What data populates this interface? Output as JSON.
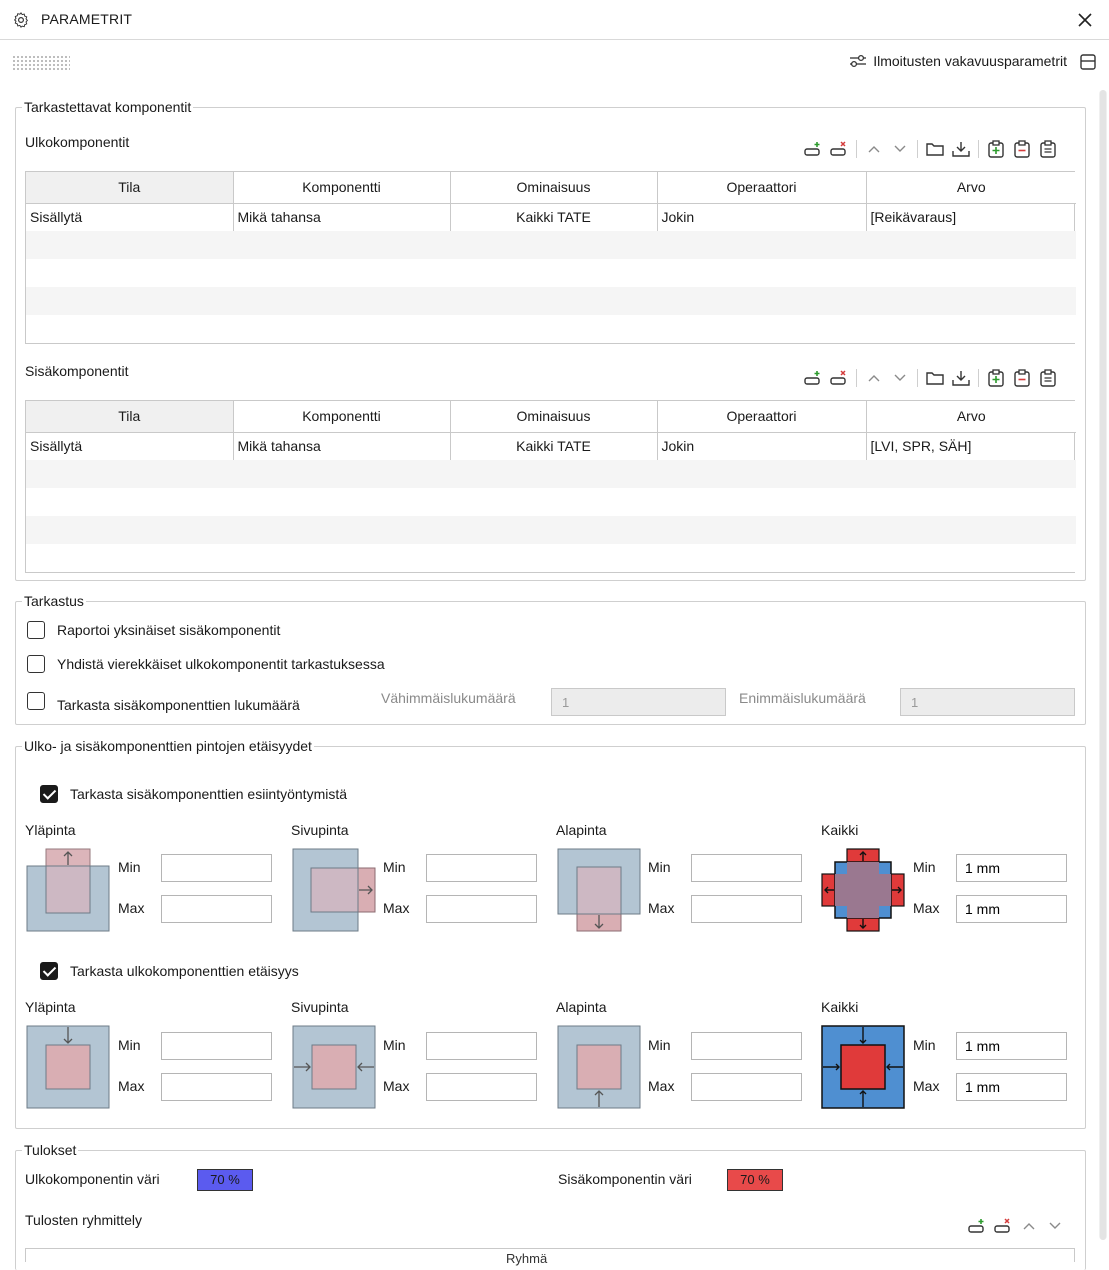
{
  "window": {
    "title": "PARAMETRIT"
  },
  "header": {
    "severity_link": "Ilmoitusten vakavuusparametrit"
  },
  "components": {
    "legend": "Tarkastettavat komponentit",
    "outer": {
      "title": "Ulkokomponentit",
      "columns": [
        "Tila",
        "Komponentti",
        "Ominaisuus",
        "Operaattori",
        "Arvo"
      ],
      "rows": [
        {
          "tila": "Sisällytä",
          "komponentti": "Mikä tahansa",
          "ominaisuus": "Kaikki TATE",
          "operaattori": "Jokin",
          "arvo": "[Reikävaraus]"
        }
      ]
    },
    "inner": {
      "title": "Sisäkomponentit",
      "columns": [
        "Tila",
        "Komponentti",
        "Ominaisuus",
        "Operaattori",
        "Arvo"
      ],
      "rows": [
        {
          "tila": "Sisällytä",
          "komponentti": "Mikä tahansa",
          "ominaisuus": "Kaikki TATE",
          "operaattori": "Jokin",
          "arvo": "[LVI, SPR, SÄH]"
        }
      ]
    }
  },
  "check": {
    "legend": "Tarkastus",
    "options": [
      {
        "label": "Raportoi yksinäiset sisäkomponentit",
        "checked": false
      },
      {
        "label": "Yhdistä vierekkäiset ulkokomponentit tarkastuksessa",
        "checked": false
      },
      {
        "label": "Tarkasta sisäkomponenttien lukumäärä",
        "checked": false
      }
    ],
    "min_count_label": "Vähimmäislukumäärä",
    "min_count_value": "1",
    "max_count_label": "Enimmäislukumäärä",
    "max_count_value": "1"
  },
  "distances": {
    "legend": "Ulko- ja sisäkomponenttien pintojen etäisyydet",
    "overlap": {
      "label": "Tarkasta sisäkomponenttien esiintyöntymistä",
      "checked": true,
      "groups": [
        {
          "title": "Yläpinta",
          "icon": "overlap-top-icon",
          "min": "",
          "max": ""
        },
        {
          "title": "Sivupinta",
          "icon": "overlap-side-icon",
          "min": "",
          "max": ""
        },
        {
          "title": "Alapinta",
          "icon": "overlap-bottom-icon",
          "min": "",
          "max": ""
        },
        {
          "title": "Kaikki",
          "icon": "overlap-all-icon",
          "min": "1 mm",
          "max": "1 mm"
        }
      ]
    },
    "clearance": {
      "label": "Tarkasta ulkokomponenttien etäisyys",
      "checked": true,
      "groups": [
        {
          "title": "Yläpinta",
          "icon": "clearance-top-icon",
          "min": "",
          "max": ""
        },
        {
          "title": "Sivupinta",
          "icon": "clearance-side-icon",
          "min": "",
          "max": ""
        },
        {
          "title": "Alapinta",
          "icon": "clearance-bottom-icon",
          "min": "",
          "max": ""
        },
        {
          "title": "Kaikki",
          "icon": "clearance-all-icon",
          "min": "1 mm",
          "max": "1 mm"
        }
      ]
    },
    "min_label": "Min",
    "max_label": "Max"
  },
  "results": {
    "legend": "Tulokset",
    "outer_color_label": "Ulkokomponentin väri",
    "outer_color_value": "70 %",
    "outer_color": "#5b5bef",
    "inner_color_label": "Sisäkomponentin väri",
    "inner_color_value": "70 %",
    "inner_color": "#e84a4a",
    "grouping_title": "Tulosten ryhmittely",
    "grouping_header": "Ryhmä"
  },
  "colors": {
    "accent_blue": "#5b5bef",
    "accent_red": "#e84a4a",
    "steel": "#b3c5d3",
    "pink": "#d9aeb3"
  }
}
